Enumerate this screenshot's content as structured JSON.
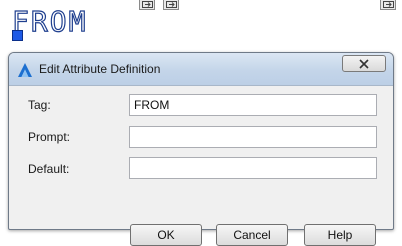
{
  "canvas": {
    "attribute_text": "FROM"
  },
  "dialog": {
    "title": "Edit Attribute Definition",
    "close_icon_name": "close-icon",
    "fields": {
      "tag_label": "Tag:",
      "tag_value": "FROM",
      "prompt_label": "Prompt:",
      "prompt_value": "",
      "default_label": "Default:",
      "default_value": ""
    },
    "buttons": {
      "ok": "OK",
      "cancel": "Cancel",
      "help": "Help"
    }
  },
  "colors": {
    "titlebar": "#c4d5e9",
    "dialog_bg": "#f0f0f0",
    "cad_text_outline": "#1f3f8f",
    "grip": "#1e5ae6"
  }
}
